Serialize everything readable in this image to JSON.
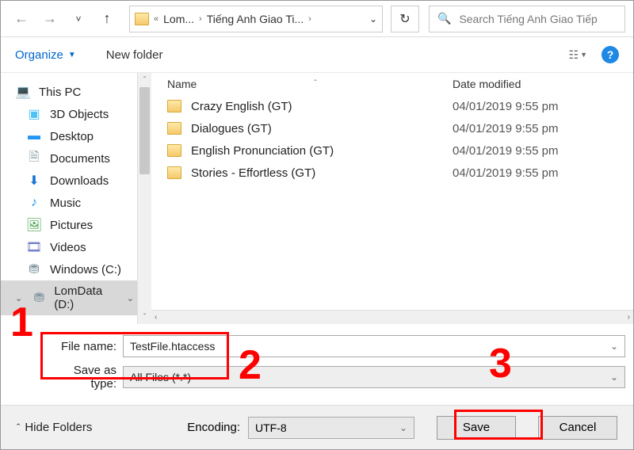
{
  "nav": {
    "breadcrumb_parent": "Lom...",
    "breadcrumb_current": "Tiếng Anh Giao Ti...",
    "search_placeholder": "Search Tiếng Anh Giao Tiếp"
  },
  "toolbar": {
    "organize": "Organize",
    "new_folder": "New folder"
  },
  "sidebar": {
    "root": "This PC",
    "items": [
      {
        "label": "3D Objects"
      },
      {
        "label": "Desktop"
      },
      {
        "label": "Documents"
      },
      {
        "label": "Downloads"
      },
      {
        "label": "Music"
      },
      {
        "label": "Pictures"
      },
      {
        "label": "Videos"
      },
      {
        "label": "Windows (C:)"
      },
      {
        "label": "LomData (D:)"
      }
    ]
  },
  "columns": {
    "name": "Name",
    "date": "Date modified"
  },
  "files": [
    {
      "name": "Crazy English (GT)",
      "date": "04/01/2019 9:55 pm"
    },
    {
      "name": "Dialogues (GT)",
      "date": "04/01/2019 9:55 pm"
    },
    {
      "name": "English Pronunciation (GT)",
      "date": "04/01/2019 9:55 pm"
    },
    {
      "name": "Stories - Effortless (GT)",
      "date": "04/01/2019 9:55 pm"
    }
  ],
  "fields": {
    "file_name_label": "File name:",
    "file_name_value": "TestFile.htaccess",
    "type_label": "Save as type:",
    "type_value": "All Files  (*.*)"
  },
  "bottom": {
    "hide_folders": "Hide Folders",
    "encoding_label": "Encoding:",
    "encoding_value": "UTF-8",
    "save": "Save",
    "cancel": "Cancel"
  },
  "annotations": {
    "n1": "1",
    "n2": "2",
    "n3": "3"
  }
}
